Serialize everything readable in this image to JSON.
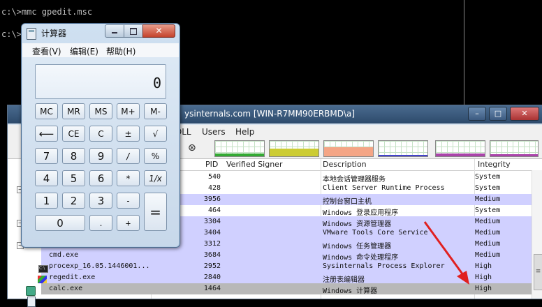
{
  "console": {
    "line1": "c:\\>mmc gpedit.msc",
    "line2": "c:\\>"
  },
  "process_explorer": {
    "title": "ysinternals.com [WIN-R7MM90ERBMD\\a]",
    "menu": [
      "DLL",
      "Users",
      "Help"
    ],
    "columns": {
      "pid": "PID",
      "signer": "Verified Signer",
      "description": "Description",
      "integrity": "Integrity"
    },
    "rows": [
      {
        "name": "",
        "pid": "540",
        "description": "本地会话管理器服务",
        "integrity": "System",
        "style": "normal"
      },
      {
        "name": "",
        "pid": "428",
        "description": "Client Server Runtime Process",
        "integrity": "System",
        "style": "normal"
      },
      {
        "name": "",
        "pid": "3956",
        "description": "控制台窗口主机",
        "integrity": "Medium",
        "style": "hl"
      },
      {
        "name": "",
        "pid": "464",
        "description": "Windows 登录应用程序",
        "integrity": "System",
        "style": "normal"
      },
      {
        "name": "",
        "pid": "3304",
        "description": "Windows 资源管理器",
        "integrity": "Medium",
        "style": "hl"
      },
      {
        "name": "",
        "pid": "3404",
        "description": "VMware Tools Core Service",
        "integrity": "Medium",
        "style": "hl"
      },
      {
        "name": "",
        "pid": "3312",
        "description": "Windows 任务管理器",
        "integrity": "Medium",
        "style": "hl"
      },
      {
        "name": "cmd.exe",
        "pid": "3684",
        "description": "Windows 命令处理程序",
        "integrity": "Medium",
        "style": "hl"
      },
      {
        "name": "procexp_16.05.1446001...",
        "pid": "2952",
        "description": "Sysinternals Process Explorer",
        "integrity": "High",
        "style": "hl"
      },
      {
        "name": "regedit.exe",
        "pid": "2840",
        "description": "注册表编辑器",
        "integrity": "High",
        "style": "hl"
      },
      {
        "name": "calc.exe",
        "pid": "1464",
        "description": "Windows 计算器",
        "integrity": "High",
        "style": "sel"
      }
    ],
    "tree_markers": [
      "−",
      "−",
      "−"
    ],
    "scroll_thumb": "≡"
  },
  "calculator": {
    "title": "计算器",
    "menu": [
      "查看(V)",
      "编辑(E)",
      "帮助(H)"
    ],
    "display": "0",
    "keys": {
      "mc": "MC",
      "mr": "MR",
      "ms": "MS",
      "mplus": "M+",
      "mminus": "M-",
      "back": "⟵",
      "ce": "CE",
      "c": "C",
      "pm": "±",
      "sqrt": "√",
      "k7": "7",
      "k8": "8",
      "k9": "9",
      "div": "/",
      "pct": "%",
      "k4": "4",
      "k5": "5",
      "k6": "6",
      "mul": "*",
      "recip": "1/x",
      "k1": "1",
      "k2": "2",
      "k3": "3",
      "sub": "-",
      "eq": "=",
      "k0": "0",
      "dot": ".",
      "add": "+"
    },
    "close_glyph": "✕"
  },
  "colors": {
    "accent_arrow": "#e02020",
    "highlight_row": "#d0d0ff",
    "selected_row": "#b8b8b8"
  }
}
